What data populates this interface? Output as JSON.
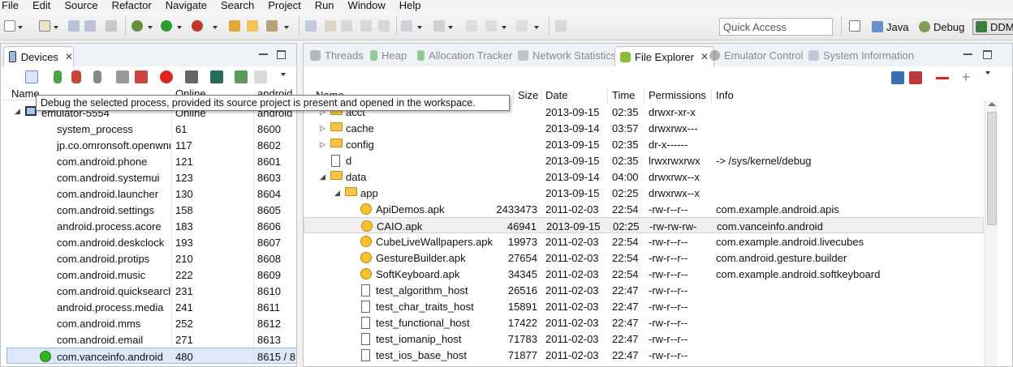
{
  "menu": [
    "File",
    "Edit",
    "Source",
    "Refactor",
    "Navigate",
    "Search",
    "Project",
    "Run",
    "Window",
    "Help"
  ],
  "toolbar": {
    "quick_access_placeholder": "Quick Access",
    "perspectives": [
      "Java",
      "Debug",
      "DDM"
    ]
  },
  "devices_panel": {
    "tab_label": "Devices",
    "columns": {
      "name": "Name",
      "status": "Online",
      "port": "android"
    },
    "emulator": {
      "name": "emulator-5554",
      "status": "Online",
      "port": "android"
    },
    "tooltip": "Debug the selected process, provided its source project is present and opened in the workspace.",
    "processes": [
      {
        "name": "system_process",
        "pid": "61",
        "port": "8600"
      },
      {
        "name": "jp.co.omronsoft.openwnn",
        "pid": "117",
        "port": "8602"
      },
      {
        "name": "com.android.phone",
        "pid": "121",
        "port": "8601"
      },
      {
        "name": "com.android.systemui",
        "pid": "123",
        "port": "8603"
      },
      {
        "name": "com.android.launcher",
        "pid": "130",
        "port": "8604"
      },
      {
        "name": "com.android.settings",
        "pid": "158",
        "port": "8605"
      },
      {
        "name": "android.process.acore",
        "pid": "183",
        "port": "8606"
      },
      {
        "name": "com.android.deskclock",
        "pid": "193",
        "port": "8607"
      },
      {
        "name": "com.android.protips",
        "pid": "210",
        "port": "8608"
      },
      {
        "name": "com.android.music",
        "pid": "222",
        "port": "8609"
      },
      {
        "name": "com.android.quicksearchbox",
        "pid": "231",
        "port": "8610"
      },
      {
        "name": "android.process.media",
        "pid": "241",
        "port": "8611"
      },
      {
        "name": "com.android.mms",
        "pid": "252",
        "port": "8612"
      },
      {
        "name": "com.android.email",
        "pid": "271",
        "port": "8613"
      },
      {
        "name": "com.vanceinfo.android",
        "pid": "480",
        "port": "8615 / 8"
      }
    ]
  },
  "right_tabs": [
    "Threads",
    "Heap",
    "Allocation Tracker",
    "Network Statistics",
    "File Explorer",
    "Emulator Control",
    "System Information"
  ],
  "file_explorer": {
    "headers": {
      "name": "Name",
      "size": "Size",
      "date": "Date",
      "time": "Time",
      "permissions": "Permissions",
      "info": "Info"
    },
    "rows": [
      {
        "name": "acct",
        "size": "",
        "date": "2013-09-15",
        "time": "02:35",
        "perm": "drwxr-xr-x",
        "info": "",
        "icon": "folder",
        "level": 0,
        "twisty": "▷"
      },
      {
        "name": "cache",
        "size": "",
        "date": "2013-09-14",
        "time": "03:57",
        "perm": "drwxrwx---",
        "info": "",
        "icon": "folder",
        "level": 0,
        "twisty": "▷"
      },
      {
        "name": "config",
        "size": "",
        "date": "2013-09-15",
        "time": "02:35",
        "perm": "dr-x------",
        "info": "",
        "icon": "folder",
        "level": 0,
        "twisty": "▷"
      },
      {
        "name": "d",
        "size": "",
        "date": "2013-09-15",
        "time": "02:35",
        "perm": "lrwxrwxrwx",
        "info": "-> /sys/kernel/debug",
        "icon": "file",
        "level": 0,
        "twisty": ""
      },
      {
        "name": "data",
        "size": "",
        "date": "2013-09-14",
        "time": "04:00",
        "perm": "drwxrwx--x",
        "info": "",
        "icon": "folder",
        "level": 0,
        "twisty": "◢"
      },
      {
        "name": "app",
        "size": "",
        "date": "2013-09-15",
        "time": "02:25",
        "perm": "drwxrwx--x",
        "info": "",
        "icon": "folder",
        "level": 1,
        "twisty": "◢"
      },
      {
        "name": "ApiDemos.apk",
        "size": "2433473",
        "date": "2011-02-03",
        "time": "22:54",
        "perm": "-rw-r--r--",
        "info": "com.example.android.apis",
        "icon": "apk",
        "level": 2,
        "twisty": ""
      },
      {
        "name": "CAIO.apk",
        "size": "46941",
        "date": "2013-09-15",
        "time": "02:25",
        "perm": "-rw-rw-rw-",
        "info": "com.vanceinfo.android",
        "icon": "apk",
        "level": 2,
        "twisty": "",
        "selected": true
      },
      {
        "name": "CubeLiveWallpapers.apk",
        "size": "19973",
        "date": "2011-02-03",
        "time": "22:54",
        "perm": "-rw-r--r--",
        "info": "com.example.android.livecubes",
        "icon": "apk",
        "level": 2,
        "twisty": ""
      },
      {
        "name": "GestureBuilder.apk",
        "size": "27654",
        "date": "2011-02-03",
        "time": "22:54",
        "perm": "-rw-r--r--",
        "info": "com.android.gesture.builder",
        "icon": "apk",
        "level": 2,
        "twisty": ""
      },
      {
        "name": "SoftKeyboard.apk",
        "size": "34345",
        "date": "2011-02-03",
        "time": "22:54",
        "perm": "-rw-r--r--",
        "info": "com.example.android.softkeyboard",
        "icon": "apk",
        "level": 2,
        "twisty": ""
      },
      {
        "name": "test_algorithm_host",
        "size": "26516",
        "date": "2011-02-03",
        "time": "22:47",
        "perm": "-rw-r--r--",
        "info": "",
        "icon": "file",
        "level": 2,
        "twisty": ""
      },
      {
        "name": "test_char_traits_host",
        "size": "15891",
        "date": "2011-02-03",
        "time": "22:47",
        "perm": "-rw-r--r--",
        "info": "",
        "icon": "file",
        "level": 2,
        "twisty": ""
      },
      {
        "name": "test_functional_host",
        "size": "17422",
        "date": "2011-02-03",
        "time": "22:47",
        "perm": "-rw-r--r--",
        "info": "",
        "icon": "file",
        "level": 2,
        "twisty": ""
      },
      {
        "name": "test_iomanip_host",
        "size": "71783",
        "date": "2011-02-03",
        "time": "22:47",
        "perm": "-rw-r--r--",
        "info": "",
        "icon": "file",
        "level": 2,
        "twisty": ""
      },
      {
        "name": "test_ios_base_host",
        "size": "71877",
        "date": "2011-02-03",
        "time": "22:47",
        "perm": "-rw-r--r--",
        "info": "",
        "icon": "file",
        "level": 2,
        "twisty": ""
      }
    ]
  },
  "colors": {
    "selection": "#dde9f8",
    "debug_green": "#33b51f",
    "folder": "#f5c34a"
  }
}
